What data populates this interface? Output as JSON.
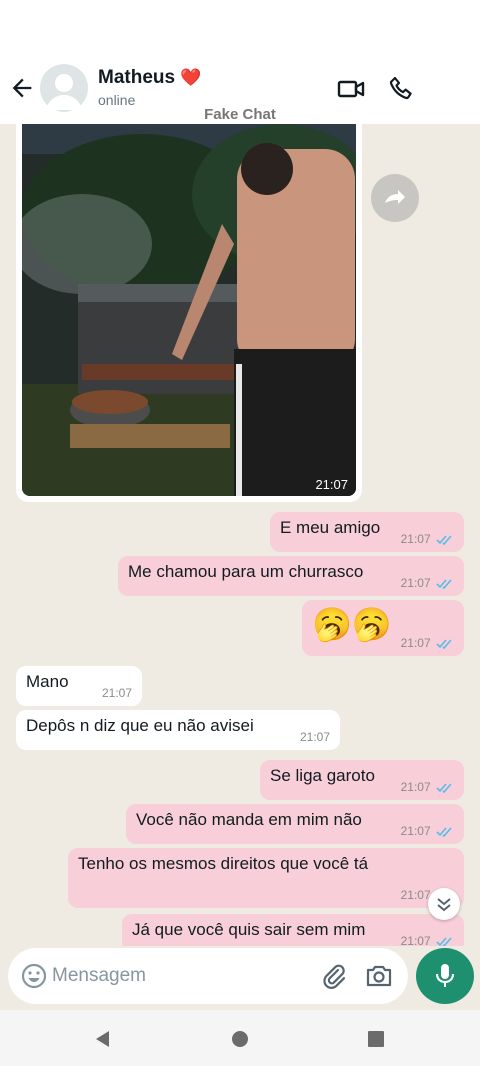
{
  "header": {
    "contact_name": "Matheus",
    "heart": "❤️",
    "status": "online",
    "banner": "Fake Chat",
    "icons": [
      "back-arrow-icon",
      "video-call-icon",
      "phone-icon"
    ]
  },
  "photo_message": {
    "time": "21:07"
  },
  "messages": [
    {
      "dir": "out",
      "text": "E meu amigo",
      "time": "21:07",
      "read": true
    },
    {
      "dir": "out",
      "text": "Me chamou para um churrasco",
      "time": "21:07",
      "read": true
    },
    {
      "dir": "out",
      "text": "🥱🥱",
      "time": "21:07",
      "read": true
    },
    {
      "dir": "in",
      "text": "Mano",
      "time": "21:07"
    },
    {
      "dir": "in",
      "text": "Depôs n diz que eu não avisei",
      "time": "21:07"
    },
    {
      "dir": "out",
      "text": "Se liga garoto",
      "time": "21:07",
      "read": true
    },
    {
      "dir": "out",
      "text": "Você não manda em mim não",
      "time": "21:07",
      "read": true
    },
    {
      "dir": "out",
      "text": "Tenho os mesmos direitos que você tá",
      "time": "21:07",
      "read": true
    },
    {
      "dir": "out",
      "text": "Já que você quis sair sem mim",
      "time": "21:07",
      "read": true
    }
  ],
  "composer": {
    "placeholder": "Mensagem"
  },
  "colors": {
    "outgoing_bubble": "#f8cfd8",
    "incoming_bubble": "#ffffff",
    "chat_background": "#efeae2",
    "read_ticks": "#53bdeb",
    "mic_button": "#1e8f6f"
  }
}
